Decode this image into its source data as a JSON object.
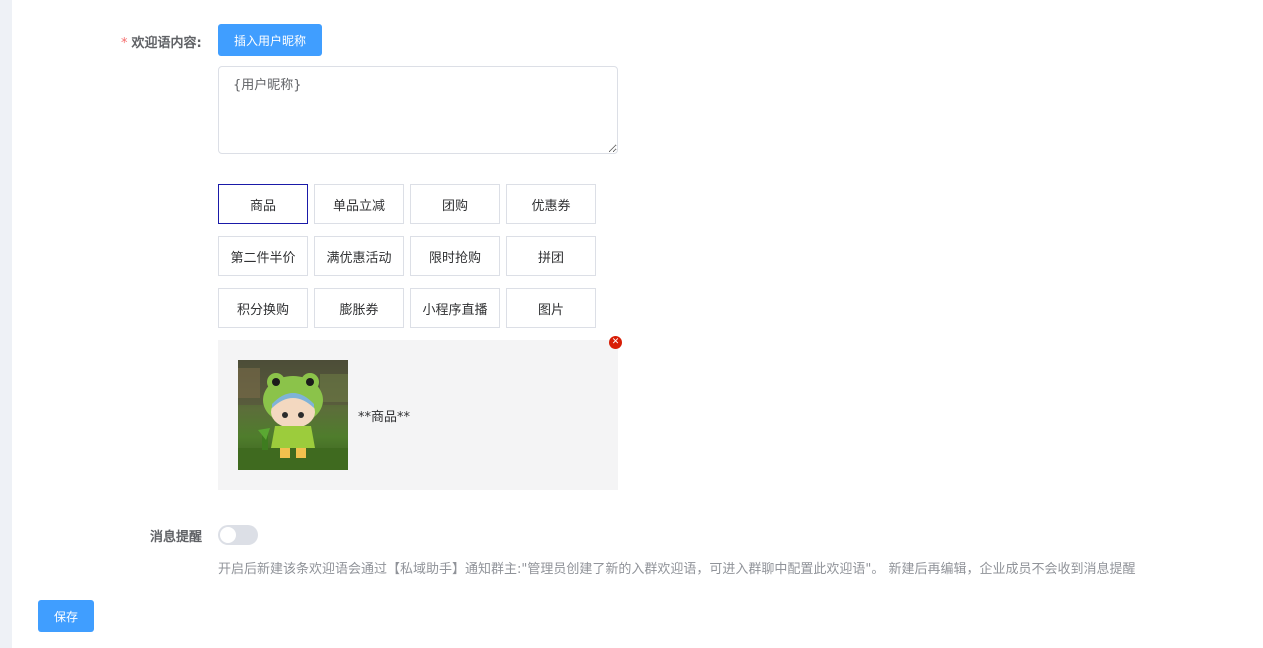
{
  "form": {
    "welcome_label": "欢迎语内容:",
    "required_mark": "*",
    "insert_nickname_button": "插入用户昵称",
    "textarea_value": "{用户昵称}",
    "tools": [
      [
        "商品",
        "单品立减",
        "团购",
        "优惠券"
      ],
      [
        "第二件半价",
        "满优惠活动",
        "限时抢购",
        "拼团"
      ],
      [
        "积分换购",
        "膨胀券",
        "小程序直播",
        "图片"
      ]
    ],
    "active_tool": "商品",
    "attachment": {
      "close_symbol": "✕",
      "title": "**商品**"
    },
    "notify_label": "消息提醒",
    "notify_enabled": false,
    "notify_help": "开启后新建该条欢迎语会通过【私域助手】通知群主:\"管理员创建了新的入群欢迎语，可进入群聊中配置此欢迎语\"。 新建后再编辑，企业成员不会收到消息提醒",
    "save_button": "保存"
  },
  "colors": {
    "primary": "#409eff",
    "required": "#f56c6c",
    "active_border": "#1a1aa8",
    "close_badge": "#d81e06"
  }
}
